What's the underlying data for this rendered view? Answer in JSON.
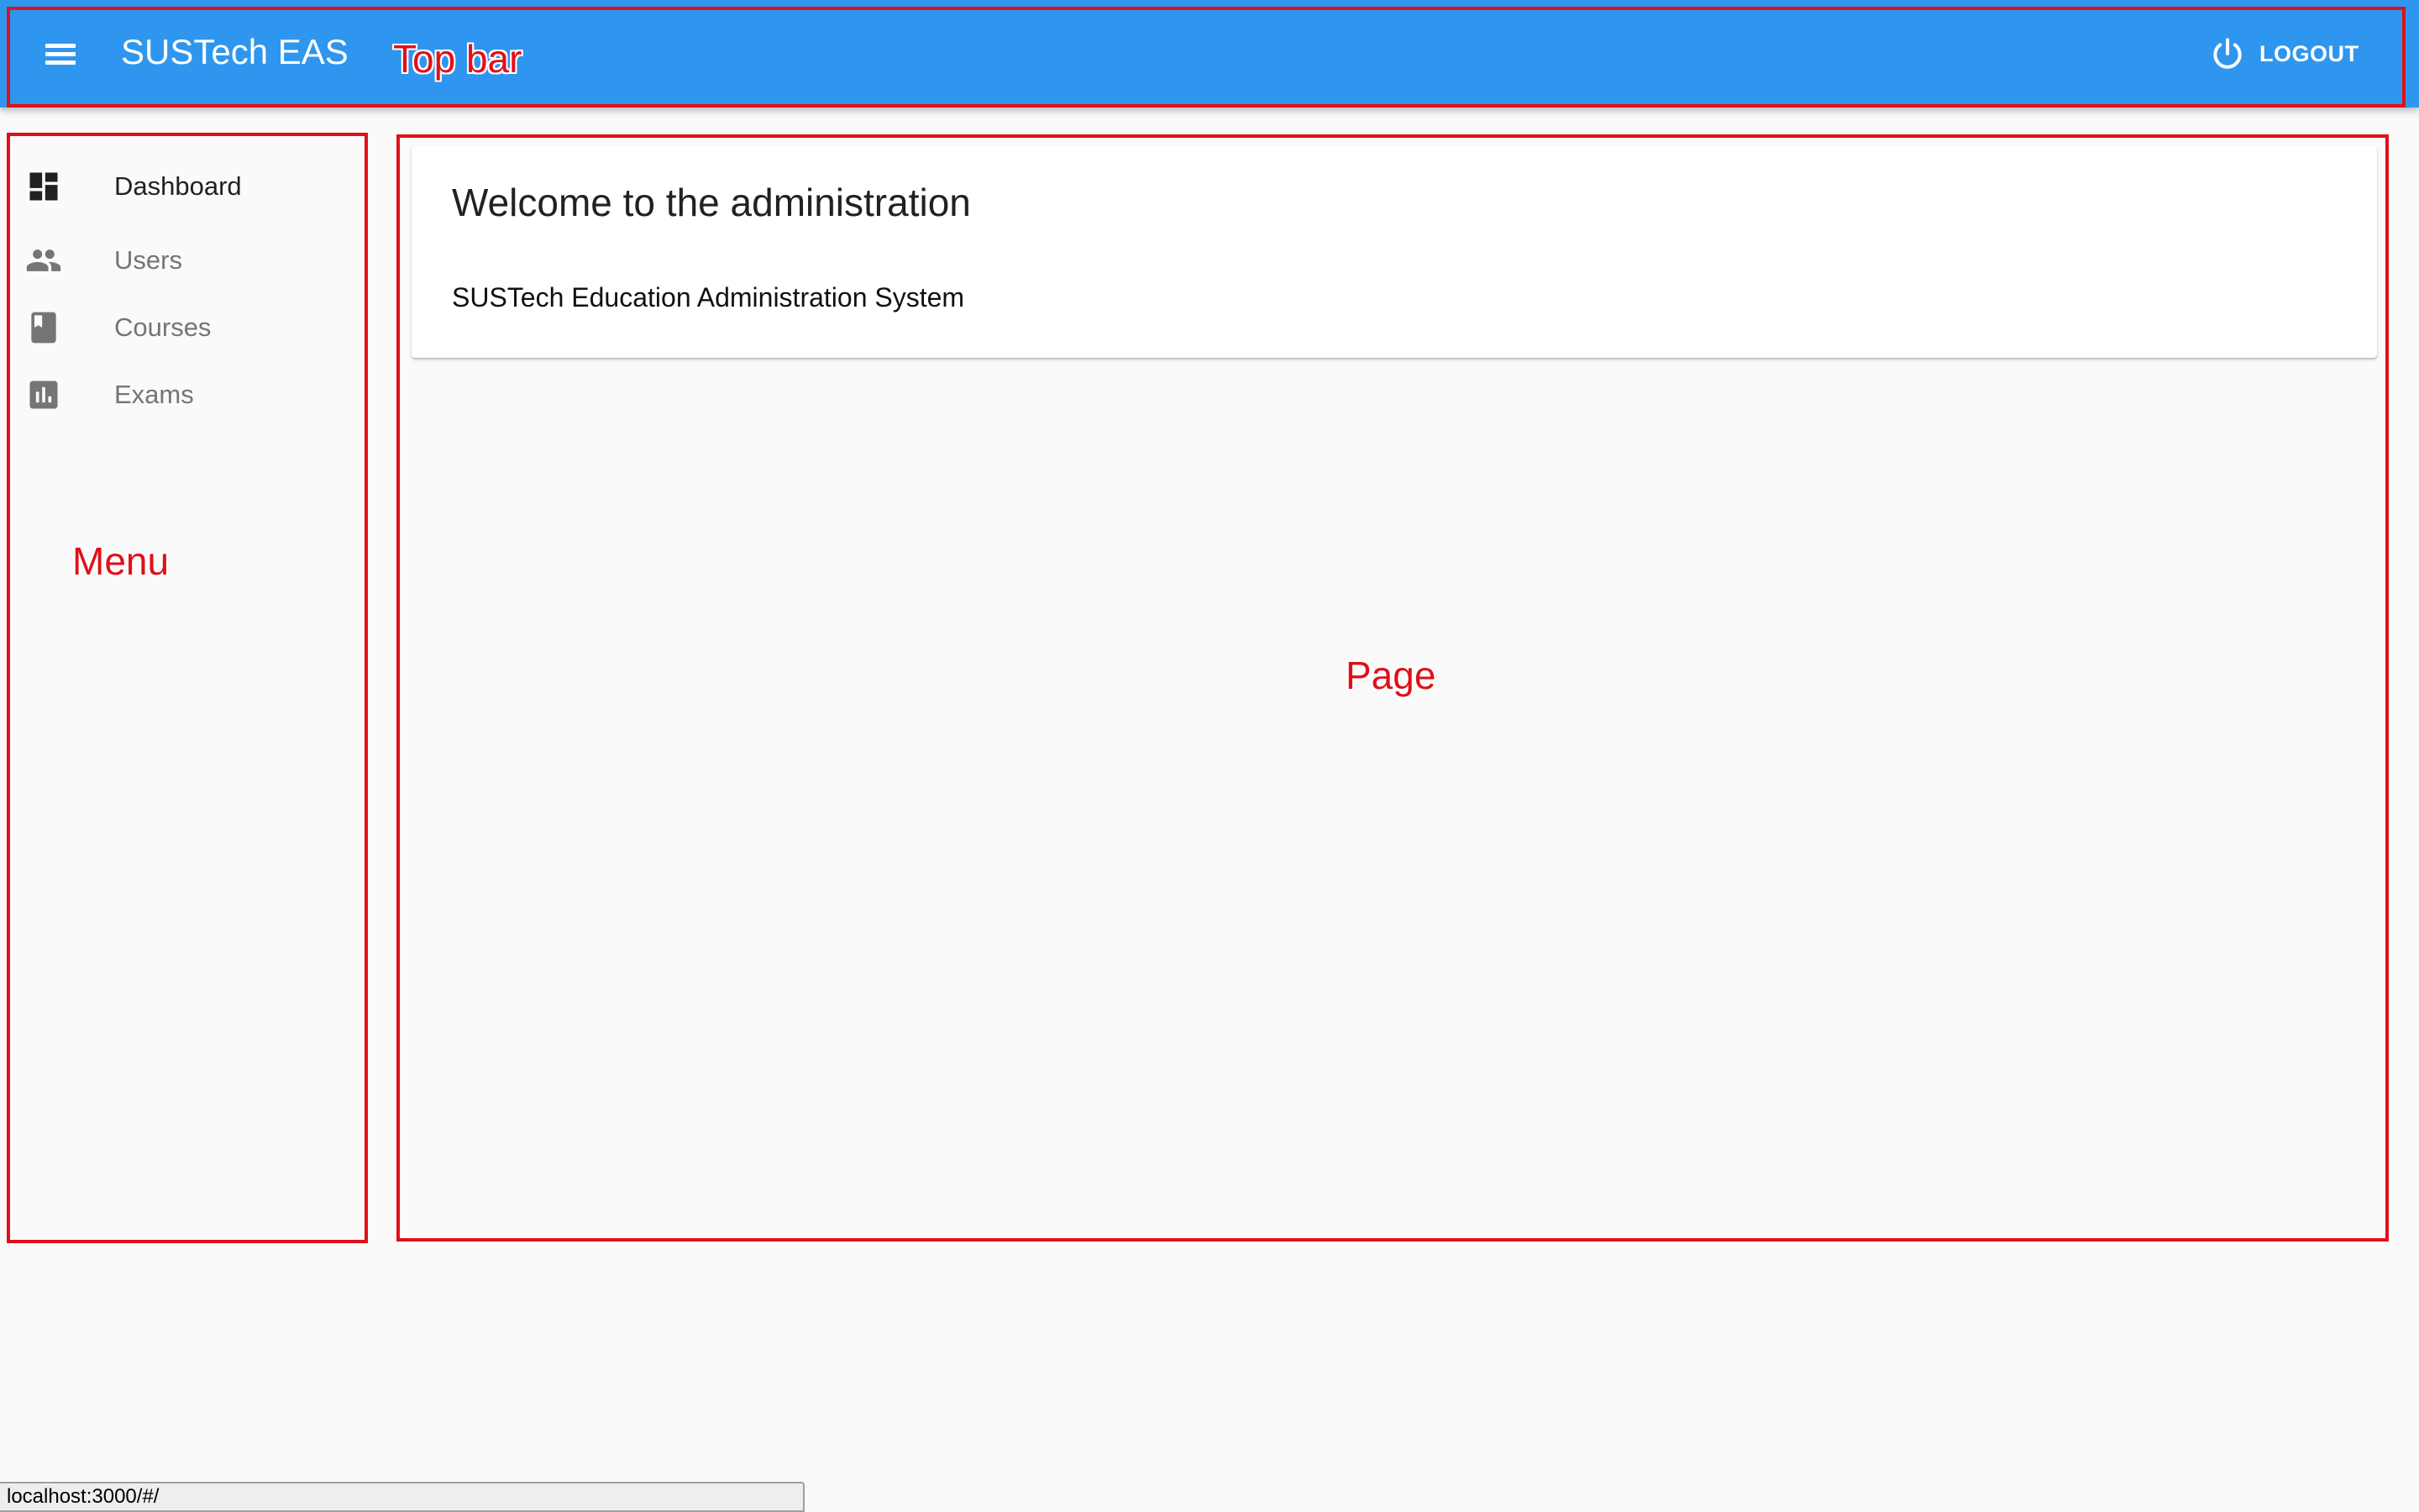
{
  "appbar": {
    "title": "SUSTech EAS",
    "logout_label": "LOGOUT",
    "color": "#2e96ee",
    "menu_icon": "menu-icon",
    "logout_icon": "power-icon"
  },
  "sidebar": {
    "items": [
      {
        "label": "Dashboard",
        "icon": "dashboard-icon",
        "active": true
      },
      {
        "label": "Users",
        "icon": "people-icon",
        "active": false
      },
      {
        "label": "Courses",
        "icon": "book-icon",
        "active": false
      },
      {
        "label": "Exams",
        "icon": "bar-chart-icon",
        "active": false
      }
    ]
  },
  "page": {
    "card_title": "Welcome to the administration",
    "card_body": "SUSTech Education Administration System"
  },
  "annotations": {
    "top_bar": "Top bar",
    "menu": "Menu",
    "page": "Page",
    "color": "#e0101a"
  },
  "statusbar": {
    "url": "localhost:3000/#/"
  }
}
